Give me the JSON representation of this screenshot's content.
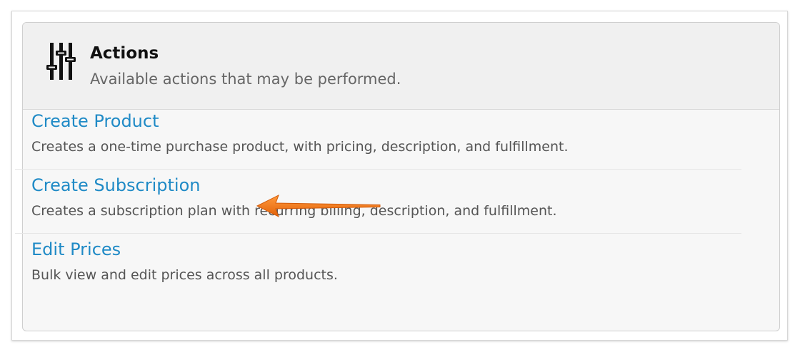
{
  "panel": {
    "icon": "sliders-icon",
    "title": "Actions",
    "subtitle": "Available actions that may be performed."
  },
  "actions": [
    {
      "label": "Create Product",
      "description": "Creates a one-time purchase product, with pricing, description, and fulfillment."
    },
    {
      "label": "Create Subscription",
      "description": "Creates a subscription plan with recurring billing, description, and fulfillment."
    },
    {
      "label": "Edit Prices",
      "description": "Bulk view and edit prices across all products."
    }
  ],
  "annotation": {
    "icon": "arrow-left-icon",
    "color": "#f07a18"
  },
  "colors": {
    "link": "#1f8ac6",
    "header_bg": "#f0f0f0",
    "panel_bg": "#f7f7f7"
  }
}
